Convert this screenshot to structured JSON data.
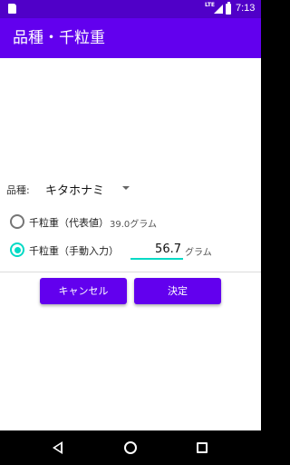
{
  "status_bar": {
    "network": "LTE",
    "time": "7:13",
    "icons": [
      "sim-card-icon",
      "signal-icon",
      "battery-icon"
    ]
  },
  "app_bar": {
    "title": "品種・千粒重"
  },
  "form": {
    "variety_label": "品種:",
    "variety_value": "キタホナミ",
    "option1_label": "千粒重（代表値）",
    "option1_value": "39.0グラム",
    "option1_selected": false,
    "option2_label": "千粒重（手動入力）",
    "option2_selected": true,
    "weight_value": "56.7",
    "weight_unit": "グラム"
  },
  "buttons": {
    "cancel": "キャンセル",
    "ok": "決定"
  },
  "colors": {
    "primary": "#6200ee",
    "status_bar": "#5000c8",
    "accent": "#03dac5"
  }
}
